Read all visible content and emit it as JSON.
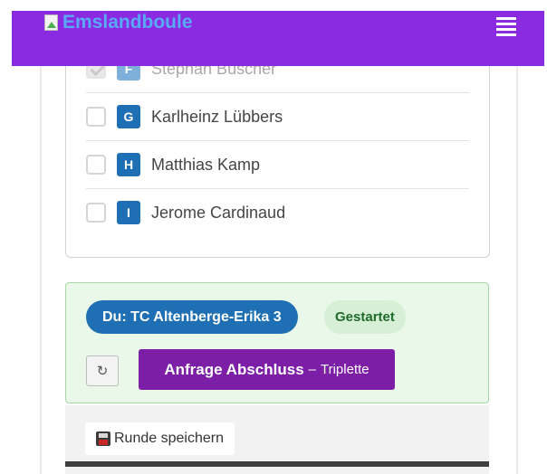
{
  "header": {
    "brand": "Emslandboule",
    "menu_icon": "hamburger-icon",
    "bg_color": "#8a2be2"
  },
  "players": [
    {
      "letter": "F",
      "name": "Stephan Buscher",
      "checked": true,
      "disabled": true
    },
    {
      "letter": "G",
      "name": "Karlheinz Lübbers",
      "checked": false,
      "disabled": false
    },
    {
      "letter": "H",
      "name": "Matthias Kamp",
      "checked": false,
      "disabled": false
    },
    {
      "letter": "I",
      "name": "Jerome Cardinaud",
      "checked": false,
      "disabled": false
    }
  ],
  "status": {
    "team": "Du: TC Altenberge-Erika 3",
    "state": "Gestartet",
    "refresh_icon": "refresh-icon",
    "request_label": "Anfrage Abschluss",
    "request_separator": "–",
    "request_sub": "Triplette"
  },
  "actions": {
    "save_label": "Runde speichern",
    "save_icon": "floppy-disk-icon"
  }
}
